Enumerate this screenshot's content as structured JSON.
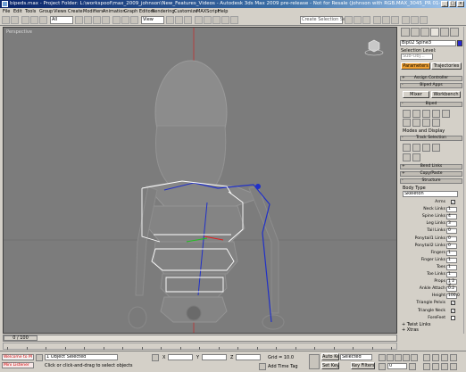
{
  "window": {
    "title": "bipeds.max - Project Folder: L:\\workspoof\\max_2009_johnson\\New_Features_Videos - Autodesk 3ds Max 2009 pre-release - Not for Resale (Johnson with RGB.MAX_3045_PR 01-18-20..."
  },
  "menu": [
    "File",
    "Edit",
    "Tools",
    "Group",
    "Views",
    "Create",
    "Modifiers",
    "Animation",
    "Graph Editors",
    "Rendering",
    "Customize",
    "MAXScript",
    "Help"
  ],
  "toolbar": {
    "filter_value": "All",
    "view_value": "View",
    "selection_set_placeholder": "Create Selection Set"
  },
  "viewport": {
    "label": "Perspective"
  },
  "command_panel": {
    "object_name": "Bip02 Spine3",
    "selection_level_label": "Selection Level:",
    "selection_level_value": "Sub-Obj...",
    "params_button": "Parameters",
    "trajectories_button": "Trajectories",
    "rollouts": {
      "assign_controller": "Assign Controller",
      "biped_apps": "Biped Apps",
      "biped": "Biped",
      "modes_display": "Modes and Display",
      "track_selection": "Track Selection",
      "bend_links": "Bend Links",
      "copy_paste": "Copy/Paste",
      "structure": "Structure",
      "twist_links": "+ Twist Links",
      "xtras": "+ Xtras"
    },
    "mixer_button": "Mixer",
    "workbench_button": "Workbench",
    "body_type_label": "Body Type",
    "body_type_value": "Skeleton",
    "params": [
      {
        "label": "Arms",
        "kind": "check",
        "value": "✓"
      },
      {
        "label": "Neck Links",
        "kind": "spin",
        "value": "1"
      },
      {
        "label": "Spine Links",
        "kind": "spin",
        "value": "4"
      },
      {
        "label": "Leg Links",
        "kind": "spin",
        "value": "3"
      },
      {
        "label": "Tail Links",
        "kind": "spin",
        "value": "0"
      },
      {
        "label": "Ponytail1 Links",
        "kind": "spin",
        "value": "0"
      },
      {
        "label": "Ponytail2 Links",
        "kind": "spin",
        "value": "0"
      },
      {
        "label": "Fingers",
        "kind": "spin",
        "value": "1"
      },
      {
        "label": "Finger Links",
        "kind": "spin",
        "value": "1"
      },
      {
        "label": "Toes",
        "kind": "spin",
        "value": "1"
      },
      {
        "label": "Toe Links",
        "kind": "spin",
        "value": "1"
      },
      {
        "label": "Props",
        "kind": "spin",
        "value": "1 2 3"
      },
      {
        "label": "Ankle Attach",
        "kind": "spin",
        "value": "0.2"
      },
      {
        "label": "Height",
        "kind": "spin",
        "value": "100.0"
      },
      {
        "label": "Triangle Pelvis",
        "kind": "check",
        "value": "✓"
      },
      {
        "label": "Triangle Neck",
        "kind": "check",
        "value": "✓"
      },
      {
        "label": "ForeFeet",
        "kind": "check",
        "value": ""
      }
    ]
  },
  "timeline": {
    "slider_label": "0 / 100"
  },
  "status": {
    "maxscript": "Welcome to M",
    "maxscript2": "Mini Listener",
    "selected": "1 Object Selected",
    "prompt": "Click or click-and-drag to select objects",
    "grid": "Grid = 10.0",
    "add_time_tag": "Add Time Tag",
    "auto_key": "Auto Key",
    "set_key": "Set Key",
    "key_mode": "Selected",
    "key_filters": "Key Filters...",
    "x_label": "X",
    "y_label": "Y",
    "z_label": "Z",
    "frame": "0"
  }
}
